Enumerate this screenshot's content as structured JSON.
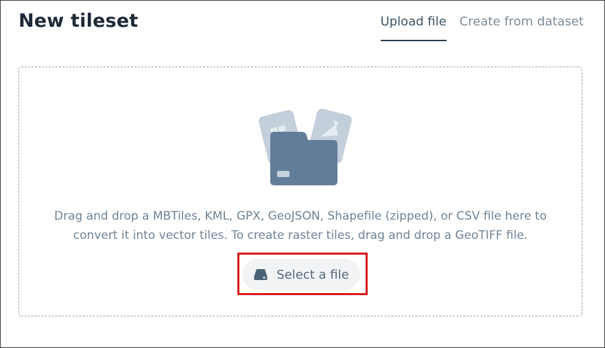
{
  "header": {
    "title": "New tileset",
    "tabs": [
      {
        "label": "Upload file",
        "active": true
      },
      {
        "label": "Create from dataset",
        "active": false
      }
    ]
  },
  "dropzone": {
    "illustration_icon": "folder-with-map-tiles-icon",
    "instructions_line1": "Drag and drop a MBTiles, KML, GPX, GeoJSON, Shapefile (zipped), or CSV file here to",
    "instructions_line2": "convert it into vector tiles. To create raster tiles, drag and drop a GeoTIFF file.",
    "select_button": {
      "label": "Select a file",
      "icon": "hard-drive-icon"
    }
  },
  "colors": {
    "title": "#1f2a37",
    "tab_active": "#3e5566",
    "tab_inactive": "#7d8d9a",
    "dropzone_border": "#8fa3b3",
    "instructions_text": "#6f8394",
    "folder_fill": "#627d9a",
    "tile_fill": "#c4cfdc",
    "button_bg": "#f1f3f5",
    "highlight": "#d7191c"
  }
}
